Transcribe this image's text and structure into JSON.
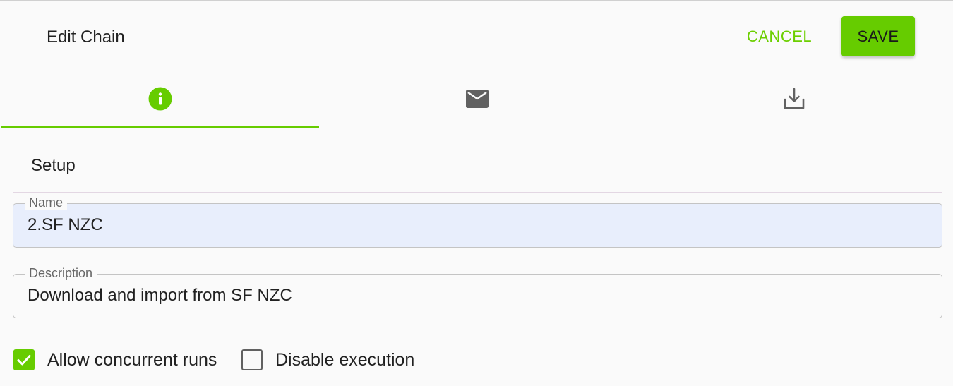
{
  "dialog": {
    "title": "Edit Chain",
    "cancel_label": "CANCEL",
    "save_label": "SAVE"
  },
  "tabs": [
    {
      "icon": "info-icon",
      "active": true
    },
    {
      "icon": "mail-icon",
      "active": false
    },
    {
      "icon": "download-icon",
      "active": false
    }
  ],
  "section": {
    "title": "Setup"
  },
  "fields": {
    "name": {
      "label": "Name",
      "value": "2.SF NZC"
    },
    "description": {
      "label": "Description",
      "value": "Download and import from SF NZC"
    }
  },
  "checkboxes": [
    {
      "label": "Allow concurrent runs",
      "checked": true
    },
    {
      "label": "Disable execution",
      "checked": false
    }
  ],
  "colors": {
    "accent": "#66cc00",
    "name_field_bg": "#e8eefc",
    "icon_gray": "#616161"
  }
}
